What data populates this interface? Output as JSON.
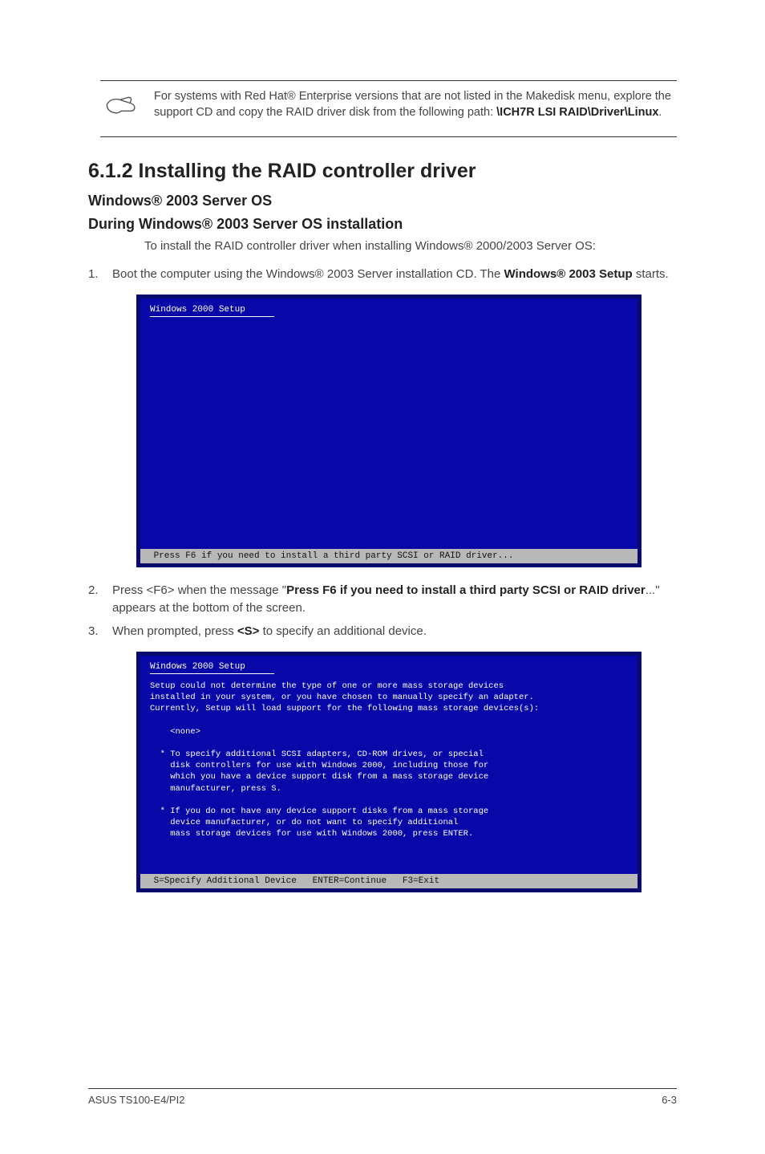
{
  "note": {
    "text_before_bold": "For systems with Red Hat® Enterprise versions that are not listed in the Makedisk menu, explore the support CD and copy the RAID driver disk from the following path: ",
    "bold_path": "\\ICH7R LSI RAID\\Driver\\Linux",
    "trailing": "."
  },
  "section_title": "6.1.2 Installing the RAID controller driver",
  "subheading": "Windows® 2003 Server OS",
  "subsubheading": "During Windows® 2003 Server OS installation",
  "intro": "To install the RAID controller driver when installing Windows® 2000/2003 Server OS:",
  "steps": {
    "s1_before": "Boot the computer using the Windows® 2003 Server installation CD. The ",
    "s1_bold": "Windows® 2003 Setup",
    "s1_after": " starts.",
    "s2_before": "Press <F6> when the message \"",
    "s2_bold": "Press F6 if you need to install a third party SCSI or RAID driver",
    "s2_after": "...\" appears at the bottom of the screen.",
    "s3_before": "When prompted, press ",
    "s3_bold": "<S>",
    "s3_after": " to specify an additional device."
  },
  "screenshot1": {
    "title": "Windows 2000 Setup",
    "status": " Press F6 if you need to install a third party SCSI or RAID driver..."
  },
  "screenshot2": {
    "title": "Windows 2000 Setup",
    "body": "Setup could not determine the type of one or more mass storage devices\ninstalled in your system, or you have chosen to manually specify an adapter.\nCurrently, Setup will load support for the following mass storage devices(s):\n\n    <none>\n\n  * To specify additional SCSI adapters, CD-ROM drives, or special\n    disk controllers for use with Windows 2000, including those for\n    which you have a device support disk from a mass storage device\n    manufacturer, press S.\n\n  * If you do not have any device support disks from a mass storage\n    device manufacturer, or do not want to specify additional\n    mass storage devices for use with Windows 2000, press ENTER.",
    "status": " S=Specify Additional Device   ENTER=Continue   F3=Exit"
  },
  "footer": {
    "left": "ASUS TS100-E4/PI2",
    "right": "6-3"
  }
}
